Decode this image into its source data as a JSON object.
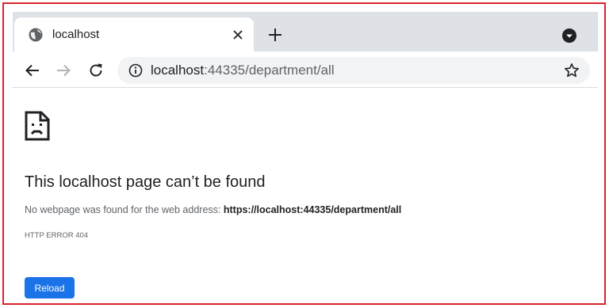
{
  "tab": {
    "title": "localhost",
    "favicon": "globe-icon",
    "close_icon": "close-icon"
  },
  "tabstrip": {
    "new_tab_icon": "plus-icon",
    "tab_search_icon": "chevron-down-circle-icon"
  },
  "toolbar": {
    "back_icon": "arrow-left-icon",
    "forward_icon": "arrow-right-icon",
    "reload_icon": "reload-icon",
    "info_icon": "info-icon",
    "bookmark_icon": "star-icon"
  },
  "omnibox": {
    "url_host": "localhost",
    "url_rest": ":44335/department/all"
  },
  "page": {
    "icon": "sad-document-icon",
    "heading": "This localhost page can’t be found",
    "description_prefix": "No webpage was found for the web address:",
    "description_url": "https://localhost:44335/department/all",
    "error_code": "HTTP ERROR 404",
    "reload_label": "Reload"
  },
  "colors": {
    "frame_border": "#d9232d",
    "tabstrip_bg": "#dee1e6",
    "omnibox_bg": "#f1f3f4",
    "reload_button_bg": "#1a73e8",
    "text_primary": "#202124",
    "text_secondary": "#5f6368"
  }
}
